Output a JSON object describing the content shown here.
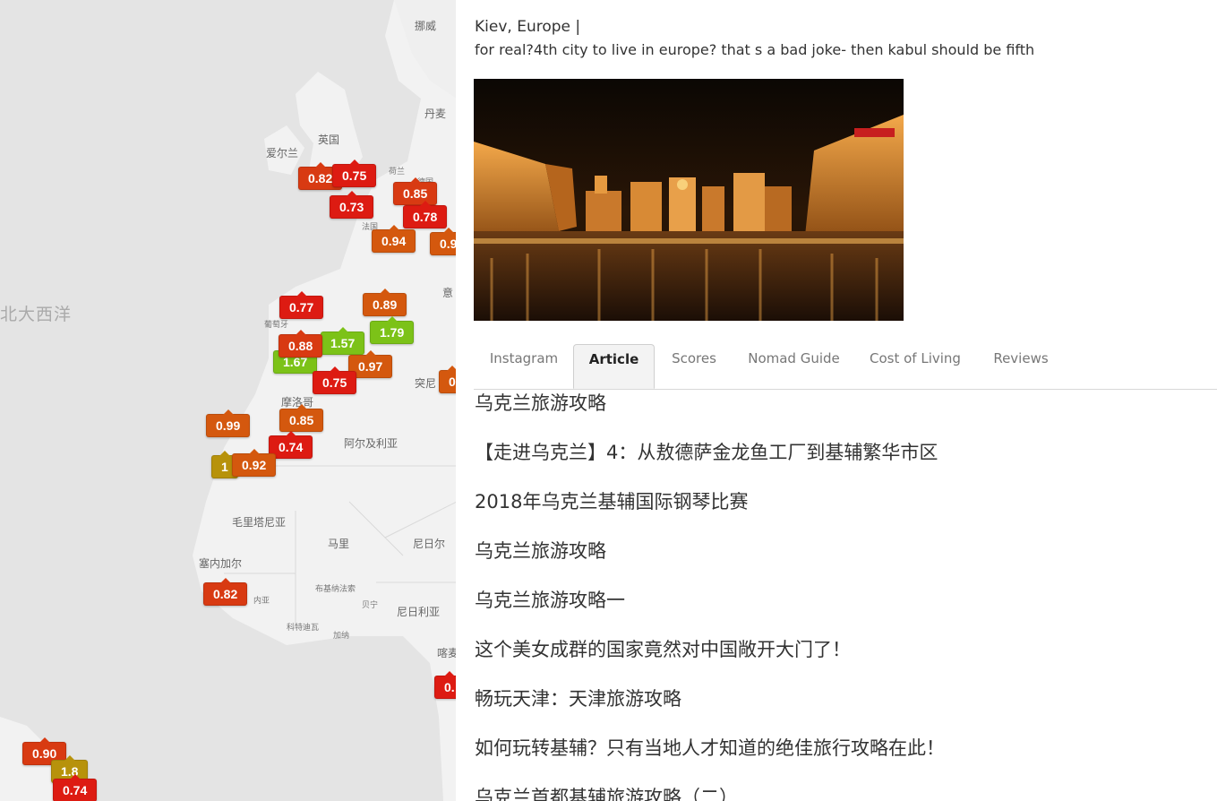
{
  "colors": {
    "red": "#dd1b12",
    "red_orange": "#d83a12",
    "orange": "#d4580e",
    "olive": "#b7920b",
    "green": "#7cc218",
    "map_land": "#f4f4f4",
    "map_water": "#e4e4e4"
  },
  "map": {
    "labels": [
      "挪威",
      "丹麦",
      "英国",
      "爱尔兰",
      "荷兰",
      "德国",
      "法国",
      "北大西洋",
      "葡萄牙",
      "突尼",
      "摩洛哥",
      "阿尔及利亚",
      "毛里塔尼亚",
      "马里",
      "尼日尔",
      "塞内加尔",
      "布基纳法索",
      "内亚",
      "贝宁",
      "尼日利亚",
      "科特迪瓦",
      "加纳",
      "喀麦",
      "意"
    ],
    "markers": [
      {
        "label": "0.82",
        "color": "red_orange"
      },
      {
        "label": "0.75",
        "color": "red"
      },
      {
        "label": "0.85",
        "color": "red_orange"
      },
      {
        "label": "0.73",
        "color": "red"
      },
      {
        "label": "0.78",
        "color": "red"
      },
      {
        "label": "0.94",
        "color": "orange"
      },
      {
        "label": "0.9",
        "color": "orange"
      },
      {
        "label": "0.77",
        "color": "red"
      },
      {
        "label": "0.89",
        "color": "orange"
      },
      {
        "label": "1.67",
        "color": "green"
      },
      {
        "label": "1.57",
        "color": "green"
      },
      {
        "label": "1.79",
        "color": "green"
      },
      {
        "label": "0.88",
        "color": "red_orange"
      },
      {
        "label": "0.97",
        "color": "orange"
      },
      {
        "label": "0.75",
        "color": "red"
      },
      {
        "label": "0.99",
        "color": "orange"
      },
      {
        "label": "0.85",
        "color": "orange"
      },
      {
        "label": "0.74",
        "color": "red"
      },
      {
        "label": "1",
        "color": "olive"
      },
      {
        "label": "0.92",
        "color": "orange"
      },
      {
        "label": "0.82",
        "color": "red_orange"
      },
      {
        "label": "0",
        "color": "orange"
      },
      {
        "label": "0.",
        "color": "red"
      },
      {
        "label": "0.90",
        "color": "red_orange"
      },
      {
        "label": "1.8",
        "color": "olive"
      },
      {
        "label": "0.74",
        "color": "red"
      }
    ]
  },
  "panel": {
    "city": "Kiev, Europe |",
    "comment": "for real?4th city to live in europe? that s a bad joke- then kabul should be fifth",
    "tabs": [
      "Instagram",
      "Article",
      "Scores",
      "Nomad Guide",
      "Cost of Living",
      "Reviews"
    ],
    "active_tab": "Article",
    "articles": [
      "乌克兰旅游攻略",
      "【走进乌克兰】4：从敖德萨金龙鱼工厂到基辅繁华市区",
      "2018年乌克兰基辅国际钢琴比赛",
      "乌克兰旅游攻略",
      "乌克兰旅游攻略一",
      "这个美女成群的国家竟然对中国敞开大门了！",
      "畅玩天津：天津旅游攻略",
      "如何玩转基辅？只有当地人才知道的绝佳旅行攻略在此！",
      "乌克兰首都基辅旅游攻略（二）"
    ]
  }
}
